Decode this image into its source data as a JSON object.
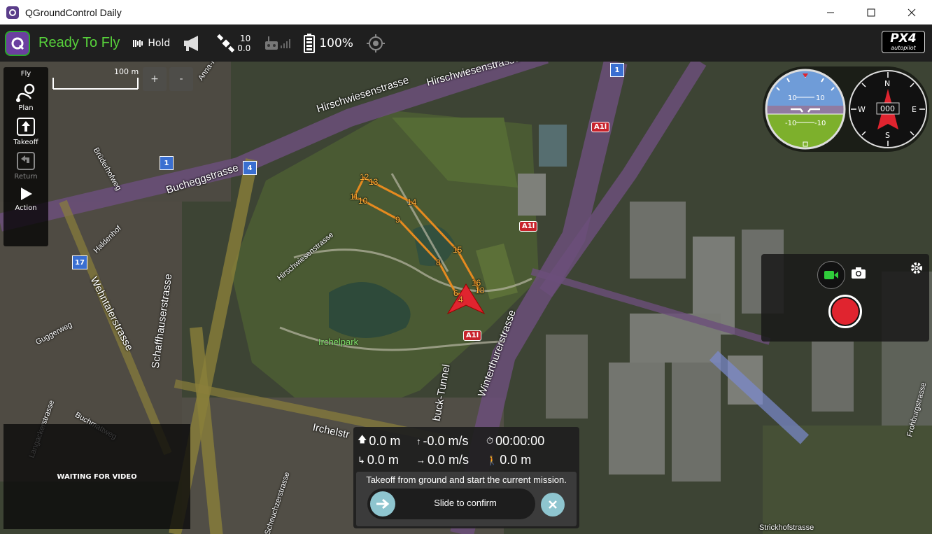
{
  "window": {
    "title": "QGroundControl Daily"
  },
  "toolbar": {
    "status": "Ready To Fly",
    "flight_mode": "Hold",
    "gps_count": "10",
    "gps_hdop": "0.0",
    "battery": "100%",
    "brand_top": "PX4",
    "brand_sub": "autopilot"
  },
  "fly_panel": {
    "title": "Fly",
    "buttons": [
      {
        "label": "Plan"
      },
      {
        "label": "Takeoff"
      },
      {
        "label": "Return"
      },
      {
        "label": "Action"
      }
    ]
  },
  "map": {
    "scale_label": "100 m",
    "zoom_in": "+",
    "zoom_out": "-",
    "labels": {
      "hirschwiesen1": "Hirschwiesenstrasse",
      "hirschwiesen2": "Hirschwiesenstrasse",
      "hirschwiesen3": "Hirschwiesenstrasse",
      "bucheggstrasse": "Bucheggstrasse",
      "wehntaler": "Wehntalerstrasse",
      "schaffhauser": "Schaffhauserstrasse",
      "winterthurer": "Winterthurerstrasse",
      "tunnel": "buck-Tunnel",
      "irchelpark": "Irchelpark",
      "irchelstr": "Irchelstr",
      "strickhof": "Strickhofstrasse",
      "frohburg": "Frohburgstrasse",
      "haldenhof": "Haldenhof",
      "guggerweg": "Guggerweg",
      "bruderhof": "Brüderhofweg",
      "anna": "Anna-Heer",
      "buchmatt": "Buchmattweg",
      "lang": "Langackerstrasse",
      "scheuchzer": "Scheuchzerstrasse"
    },
    "shields": {
      "s1a": "1",
      "s1b": "1",
      "s4": "4",
      "s17": "17",
      "a11a": "A1l",
      "a11b": "A1l",
      "a11c": "A1l"
    },
    "waypoints": [
      "4",
      "6",
      "8",
      "9",
      "10",
      "11",
      "12",
      "13",
      "14",
      "15",
      "16",
      "18"
    ]
  },
  "instruments": {
    "pitch_labels": [
      "10",
      "10",
      "-10",
      "-10"
    ],
    "compass": {
      "north": "N",
      "south": "S",
      "east": "E",
      "west": "W",
      "heading": "000"
    }
  },
  "video": {
    "status": "WAITING FOR VIDEO"
  },
  "telemetry": {
    "altitude": "0.0 m",
    "climb_rate": "-0.0 m/s",
    "flight_time": "00:00:00",
    "distance_home": "0.0 m",
    "ground_speed": "0.0 m/s",
    "distance_to_wp": "0.0 m"
  },
  "confirm": {
    "message": "Takeoff from ground and start the current mission.",
    "slider_text": "Slide to confirm"
  },
  "colors": {
    "status_green": "#57d13b",
    "waypoint_orange": "#e58a1f",
    "record_red": "#e0242f",
    "accent_teal": "#8ec5cf"
  }
}
